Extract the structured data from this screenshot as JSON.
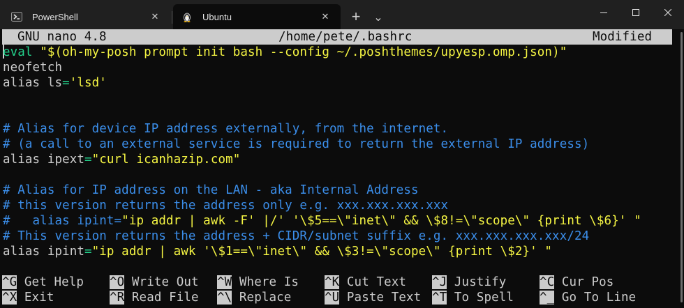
{
  "window": {
    "tabs": [
      {
        "label": "PowerShell",
        "icon": "powershell-icon",
        "active": false
      },
      {
        "label": "Ubuntu",
        "icon": "linux-penguin-icon",
        "active": true
      }
    ],
    "new_tab_glyph": "+",
    "dropdown_glyph": "⌄",
    "minimize_glyph": "—",
    "maximize_glyph": "☐",
    "close_glyph": "✕",
    "tab_close_glyph": "✕"
  },
  "nano": {
    "version": "GNU nano 4.8",
    "filename": "/home/pete/.bashrc",
    "status": "Modified",
    "lines": [
      {
        "segments": [
          {
            "t": "eval",
            "c": "kw"
          },
          {
            "t": " ",
            "c": "plain"
          },
          {
            "t": "\"$(oh-my-posh prompt init bash --config ~/.poshthemes/upyesp.omp.json)\"",
            "c": "str"
          }
        ]
      },
      {
        "segments": [
          {
            "t": "neofetch",
            "c": "plain"
          }
        ]
      },
      {
        "segments": [
          {
            "t": "alias ls",
            "c": "plain"
          },
          {
            "t": "=",
            "c": "kw"
          },
          {
            "t": "'lsd'",
            "c": "str"
          }
        ]
      },
      {
        "segments": []
      },
      {
        "segments": []
      },
      {
        "segments": [
          {
            "t": "# Alias for device IP address externally, from the internet.",
            "c": "cmt"
          }
        ]
      },
      {
        "segments": [
          {
            "t": "# (a call to an external service is required to return the external IP address)",
            "c": "cmt"
          }
        ]
      },
      {
        "segments": [
          {
            "t": "alias ipext",
            "c": "plain"
          },
          {
            "t": "=",
            "c": "kw"
          },
          {
            "t": "\"curl icanhazip.com\"",
            "c": "str"
          }
        ]
      },
      {
        "segments": []
      },
      {
        "segments": [
          {
            "t": "# Alias for IP address on the LAN - aka Internal Address",
            "c": "cmt"
          }
        ]
      },
      {
        "segments": [
          {
            "t": "# this version returns the address only e.g. xxx.xxx.xxx.xxx",
            "c": "cmt"
          }
        ]
      },
      {
        "segments": [
          {
            "t": "#   alias ipint=",
            "c": "cmt"
          },
          {
            "t": "\"ip addr | awk -F' |/' '\\$5==\\\"inet\\\" && \\$8!=\\\"scope\\\" {print \\$6}' \"",
            "c": "str"
          }
        ]
      },
      {
        "segments": [
          {
            "t": "# This version returns the address + CIDR/subnet suffix e.g. xxx.xxx.xxx.xxx/24",
            "c": "cmt"
          }
        ]
      },
      {
        "segments": [
          {
            "t": "alias ipint",
            "c": "plain"
          },
          {
            "t": "=",
            "c": "kw"
          },
          {
            "t": "\"ip addr | awk '\\$1==\\\"inet\\\" && \\$3!=\\\"scope\\\" {print \\$2}' \"",
            "c": "str"
          }
        ]
      }
    ],
    "shortcuts_row1": [
      {
        "key": "^G",
        "label": "Get Help"
      },
      {
        "key": "^O",
        "label": "Write Out"
      },
      {
        "key": "^W",
        "label": "Where Is"
      },
      {
        "key": "^K",
        "label": "Cut Text"
      },
      {
        "key": "^J",
        "label": "Justify"
      },
      {
        "key": "^C",
        "label": "Cur Pos"
      }
    ],
    "shortcuts_row2": [
      {
        "key": "^X",
        "label": "Exit"
      },
      {
        "key": "^R",
        "label": "Read File"
      },
      {
        "key": "^\\",
        "label": "Replace"
      },
      {
        "key": "^U",
        "label": "Paste Text"
      },
      {
        "key": "^T",
        "label": "To Spell"
      },
      {
        "key": "^_",
        "label": "Go To Line"
      }
    ]
  },
  "colors": {
    "background": "#0c0c0c",
    "comment": "#3b8eea",
    "keyword": "#23d18b",
    "string": "#f5f543",
    "text": "#cccccc"
  }
}
